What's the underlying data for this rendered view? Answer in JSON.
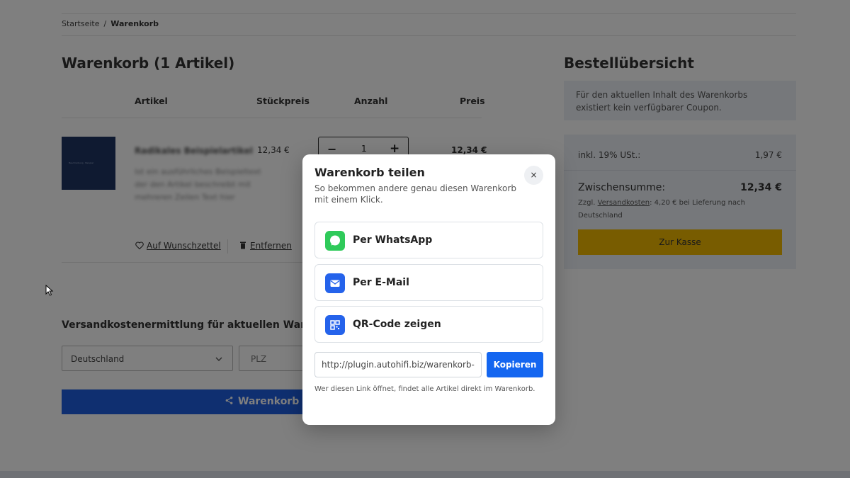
{
  "breadcrumb": {
    "home": "Startseite",
    "separator": "/",
    "current": "Warenkorb"
  },
  "cart": {
    "title": "Warenkorb (1 Artikel)",
    "columns": {
      "article": "Artikel",
      "unit_price": "Stückpreis",
      "quantity": "Anzahl",
      "price": "Preis"
    },
    "item": {
      "image_caption": "Beschreibung · Beispiel",
      "name": "Radikales Beispielartikel",
      "description": "Ist ein ausführliches Beispieltext der den Artikel beschreibt mit mehreren Zeilen Text hier",
      "unit_price": "12,34 €",
      "quantity": "1",
      "minus": "−",
      "plus": "+",
      "line_price": "12,34 €",
      "wishlist_label": "Auf Wunschzettel",
      "remove_label": "Entfernen"
    }
  },
  "shipping": {
    "title": "Versandkostenermittlung für aktuellen Warenkorb",
    "country": "Deutschland",
    "plz_placeholder": "PLZ",
    "share_label": "Warenkorb teilen"
  },
  "summary": {
    "title": "Bestellübersicht",
    "coupon_note": "Für den aktuellen Inhalt des Warenkorbs existiert kein verfügbarer Coupon.",
    "tax_label": "inkl. 19% USt.:",
    "tax_value": "1,97 €",
    "subtotal_label": "Zwischensumme:",
    "subtotal_value": "12,34 €",
    "shipping_prefix": "Zzgl.",
    "shipping_link": "Versandkosten",
    "shipping_suffix": ": 4,20 € bei Lieferung nach Deutschland",
    "checkout_label": "Zur Kasse"
  },
  "modal": {
    "title": "Warenkorb teilen",
    "subtitle": "So bekommen andere genau diesen Warenkorb mit einem Klick.",
    "close": "×",
    "options": [
      {
        "label": "Per WhatsApp",
        "icon": "whatsapp-icon"
      },
      {
        "label": "Per E-Mail",
        "icon": "mail-icon"
      },
      {
        "label": "QR-Code zeigen",
        "icon": "qr-code-icon"
      }
    ],
    "link_value": "http://plugin.autohifi.biz/warenkorb-teilen",
    "copy_label": "Kopieren",
    "note": "Wer diesen Link öffnet, findet alle Artikel direkt im Warenkorb."
  },
  "colors": {
    "primary_blue": "#1e5fe0",
    "checkout_yellow": "#f1b800",
    "whatsapp_green": "#2fca5a",
    "summary_bg": "#edf1f6"
  }
}
